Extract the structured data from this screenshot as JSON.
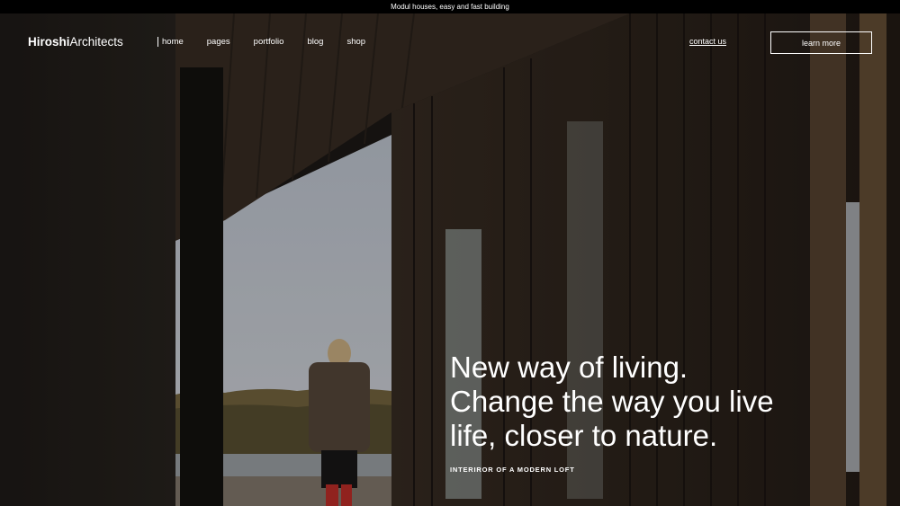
{
  "announcement": "Modul houses, easy and fast building",
  "brand": {
    "bold": "Hiroshi",
    "rest": "Architects"
  },
  "nav": {
    "items": [
      {
        "label": "home"
      },
      {
        "label": "pages"
      },
      {
        "label": "portfolio"
      },
      {
        "label": "blog"
      },
      {
        "label": "shop"
      }
    ],
    "contact_label": "contact us",
    "cta_label": "learn more"
  },
  "hero": {
    "headline_lines": [
      "New way of living.",
      "Change the way you live",
      "life, closer to nature."
    ],
    "subheading": "INTERIROR OF A MODERN LOFT"
  }
}
